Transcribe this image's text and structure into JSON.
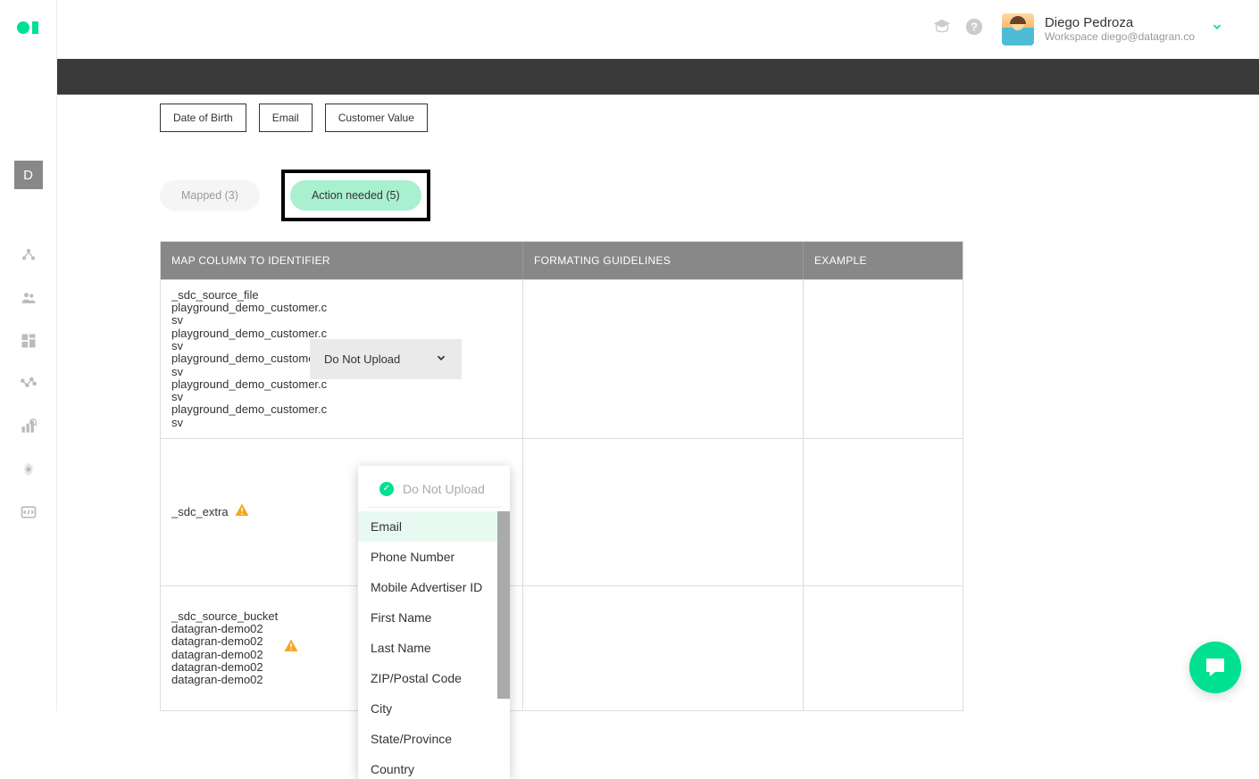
{
  "logo_label": "datagran-logo",
  "workspace_badge": "D",
  "header": {
    "user_name": "Diego Pedroza",
    "workspace_label": "Workspace diego@datagran.co"
  },
  "chips": [
    "Date of Birth",
    "Email",
    "Customer Value"
  ],
  "filters": {
    "mapped": "Mapped (3)",
    "action": "Action needed (5)"
  },
  "table": {
    "headers": {
      "col1": "MAP COLUMN TO IDENTIFIER",
      "col2": "FORMATING GUIDELINES",
      "col3": "EXAMPLE"
    },
    "rows": [
      {
        "label": "_sdc_source_file\nplayground_demo_customer.csv\nplayground_demo_customer.csv\nplayground_demo_customer.csv\nplayground_demo_customer.csv\nplayground_demo_customer.csv",
        "selected": "Do Not Upload"
      },
      {
        "label": "_sdc_extra",
        "selected": ""
      },
      {
        "label": "_sdc_source_bucket\ndatagran-demo02\ndatagran-demo02\ndatagran-demo02\ndatagran-demo02\ndatagran-demo02",
        "selected": ""
      }
    ]
  },
  "dropdown": {
    "current": "Do Not Upload",
    "options": [
      "Email",
      "Phone Number",
      "Mobile Advertiser ID",
      "First Name",
      "Last Name",
      "ZIP/Postal Code",
      "City",
      "State/Province",
      "Country"
    ]
  }
}
